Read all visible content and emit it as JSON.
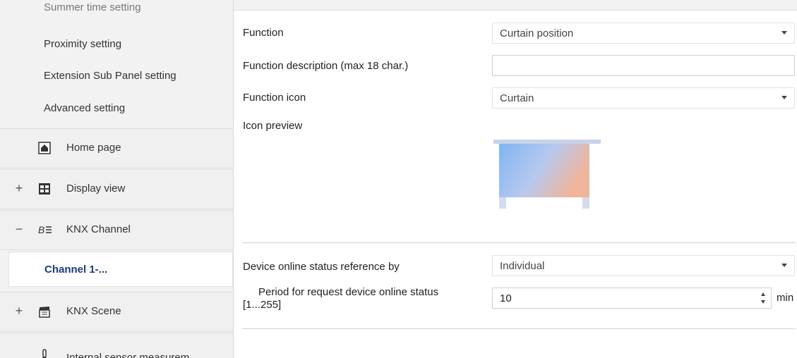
{
  "sidebar": {
    "sub_items": [
      "Summer time setting",
      "Proximity setting",
      "Extension Sub Panel setting",
      "Advanced setting"
    ],
    "nav": [
      {
        "prefix": "",
        "icon": "home-icon",
        "label": "Home page"
      },
      {
        "prefix": "+",
        "icon": "display-view-icon",
        "label": "Display view"
      },
      {
        "prefix": "−",
        "icon": "knx-channel-icon",
        "label": "KNX Channel"
      },
      {
        "prefix": "",
        "icon": "",
        "label": "Channel 1-..."
      },
      {
        "prefix": "+",
        "icon": "clapperboard-icon",
        "label": "KNX Scene"
      },
      {
        "prefix": "",
        "icon": "thermometer-icon",
        "label": "Internal sensor measurem..."
      }
    ]
  },
  "main": {
    "function": {
      "label": "Function",
      "value": "Curtain position"
    },
    "description": {
      "label": "Function description (max 18 char.)",
      "value": ""
    },
    "icon": {
      "label": "Function icon",
      "value": "Curtain"
    },
    "preview": {
      "label": "Icon preview"
    },
    "online_ref": {
      "label": "Device online status reference by",
      "value": "Individual"
    },
    "period": {
      "label_line1": "Period for request device online status",
      "label_line2": "[1...255]",
      "value": "10",
      "unit": "min"
    }
  },
  "colors": {
    "accent": "#1e3c7a",
    "sidebar_bg": "#f2f2f2"
  }
}
